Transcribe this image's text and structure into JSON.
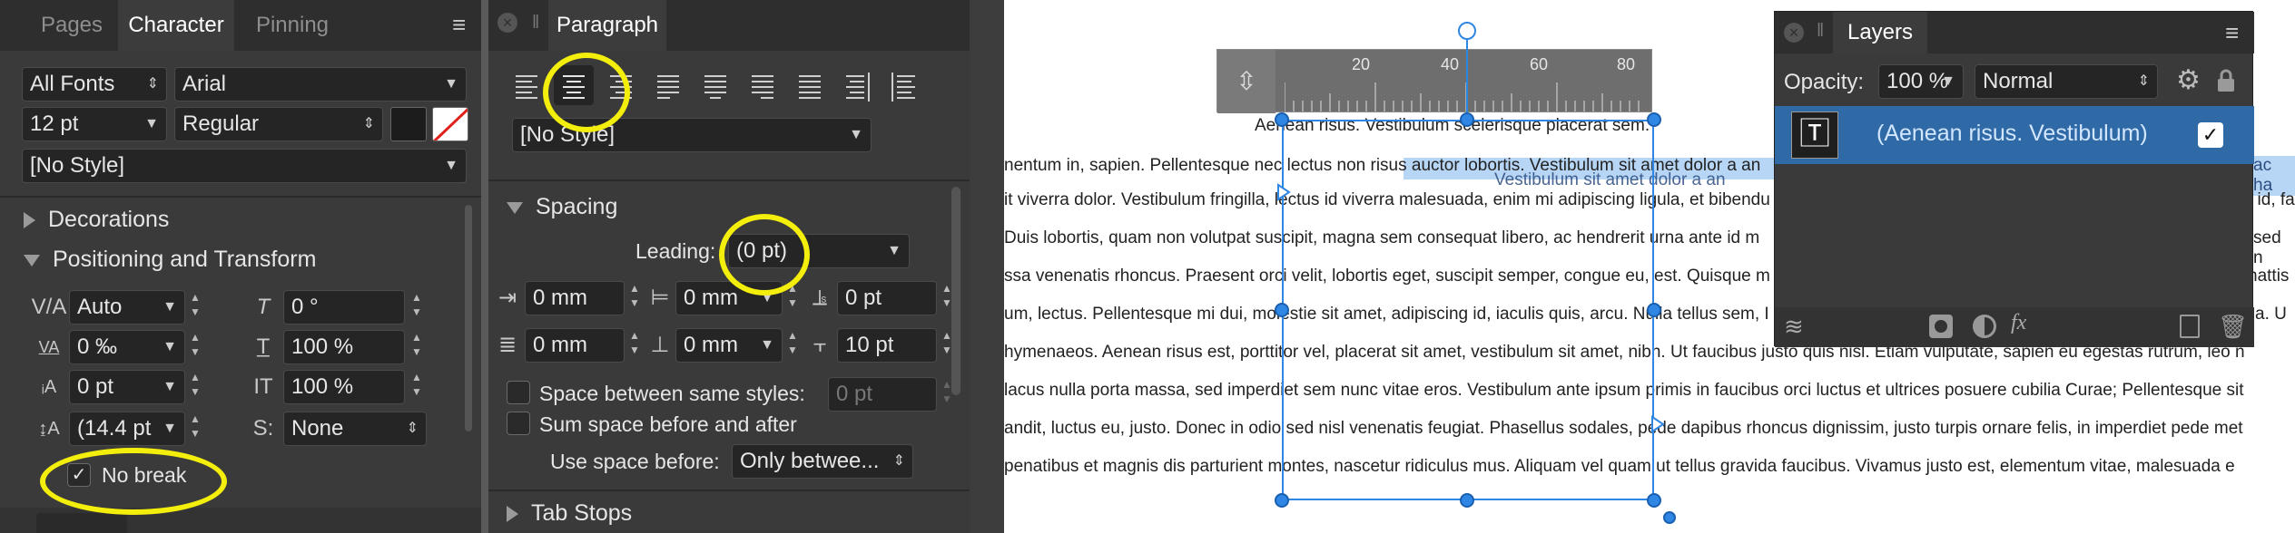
{
  "character_panel": {
    "tabs": [
      "Pages",
      "Character",
      "Pinning"
    ],
    "font_collection": "All Fonts",
    "font_family": "Arial",
    "font_size": "12 pt",
    "font_style": "Regular",
    "style": "[No Style]",
    "decorations_label": "Decorations",
    "positioning_label": "Positioning and Transform",
    "kerning": "Auto",
    "tracking": "0 ‰",
    "baseline": "0 pt",
    "leading": "(14.4 pt",
    "shear": "0 °",
    "vertical_scale": "100 %",
    "horizontal_scale": "100 %",
    "small_caps": "None",
    "no_break_label": "No break",
    "no_break_checked": true
  },
  "paragraph_panel": {
    "title": "Paragraph",
    "style": "[No Style]",
    "spacing_label": "Spacing",
    "leading_label": "Leading:",
    "leading_value": "(0 pt)",
    "left_indent": "0 mm",
    "first_line_indent": "0 mm",
    "space_before": "0 pt",
    "right_indent": "0 mm",
    "last_line_indent": "0 mm",
    "space_after": "10 pt",
    "space_between_label": "Space between same styles:",
    "space_between_value": "0 pt",
    "sum_space_label": "Sum space before and after",
    "use_space_label": "Use space before:",
    "use_space_value": "Only betwee...",
    "tab_stops_label": "Tab Stops"
  },
  "ruler": {
    "ticks": [
      "20",
      "40",
      "60",
      "80"
    ]
  },
  "document": {
    "heading": "Aenean risus. Vestibulum scelerisque placerat sem.",
    "lines": [
      "nentum in, sapien. Pellentesque nec lectus non risus auctor lobortis. Vestibulum sit amet dolor a an",
      "it viverra dolor. Vestibulum fringilla, lectus id viverra malesuada, enim mi adipiscing ligula, et bibendu",
      "Duis lobortis, quam non volutpat suscipit, magna sem consequat libero, ac hendrerit urna ante id m",
      "ssa venenatis rhoncus. Praesent orci velit, lobortis eget, suscipit semper, congue eu, est. Quisque m",
      "um, lectus. Pellentesque mi dui, molestie sit amet, adipiscing id, iaculis quis, arcu. Nulla tellus sem, I",
      "hymenaeos. Aenean risus est, porttitor vel, placerat sit amet, vestibulum sit amet, nibh. Ut faucibus justo quis nisl. Etiam vulputate, sapien eu egestas rutrum, leo n",
      "lacus nulla porta massa, sed imperdiet sem nunc vitae eros. Vestibulum ante ipsum primis in faucibus orci luctus et ultrices posuere cubilia Curae; Pellentesque sit",
      "andit, luctus eu, justo. Donec in odio sed nisl venenatis feugiat. Phasellus sodales, pede dapibus rhoncus dignissim, justo turpis ornare felis, in imperdiet pede met",
      "penatibus et magnis dis parturient montes, nascetur ridiculus mus. Aliquam vel quam ut tellus gravida faucibus. Vivamus justo est, elementum vitae, malesuada e"
    ],
    "overlap_line": "Vestibulum sit amet dolor a an",
    "right_fragments": [
      "ac ha",
      "t id, fa",
      "sed n",
      "hattis",
      "a. U"
    ]
  },
  "layers_panel": {
    "title": "Layers",
    "opacity_label": "Opacity:",
    "opacity_value": "100 %",
    "blend_mode": "Normal",
    "layer_name": "(Aenean risus. Vestibulum)",
    "layer_visible": true
  },
  "colors": {
    "highlight": "#f3ee0c",
    "selection": "#2f86e3",
    "layer_row": "#2f6aa6"
  }
}
